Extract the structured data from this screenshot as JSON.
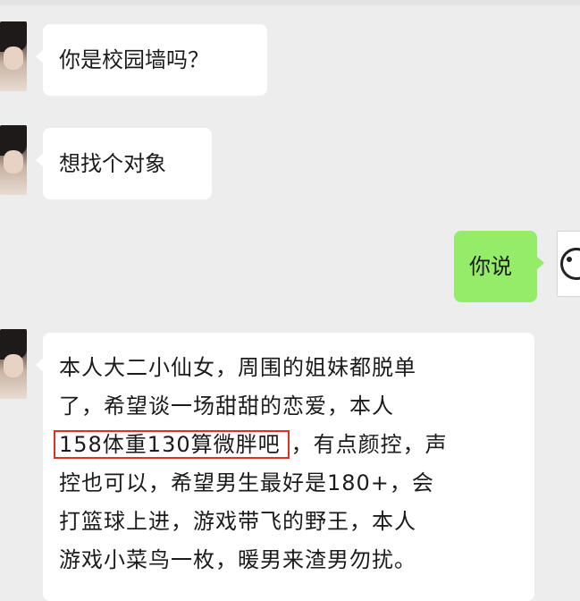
{
  "chat": {
    "messages": [
      {
        "side": "left",
        "text": "你是校园墙吗？"
      },
      {
        "side": "left",
        "text": "想找个对象"
      },
      {
        "side": "right",
        "text": "你说"
      },
      {
        "side": "left",
        "lines": [
          {
            "plain": "本人大二小仙女，周围的姐妹都脱单"
          },
          {
            "plain": "了，希望谈一场甜甜的恋爱，本人"
          },
          {
            "highlight": "158体重130算微胖吧",
            "rest": "，有点颜控，声"
          },
          {
            "plain": "控也可以，希望男生最好是180+，会"
          },
          {
            "plain": "打篮球上进，游戏带飞的野王，本人"
          },
          {
            "plain": "游戏小菜鸟一枚，暖男来渣男勿扰。"
          }
        ]
      }
    ],
    "colors": {
      "background": "#ededed",
      "incoming_bubble": "#ffffff",
      "outgoing_bubble": "#95ec69",
      "highlight_border": "#e0301e"
    }
  }
}
